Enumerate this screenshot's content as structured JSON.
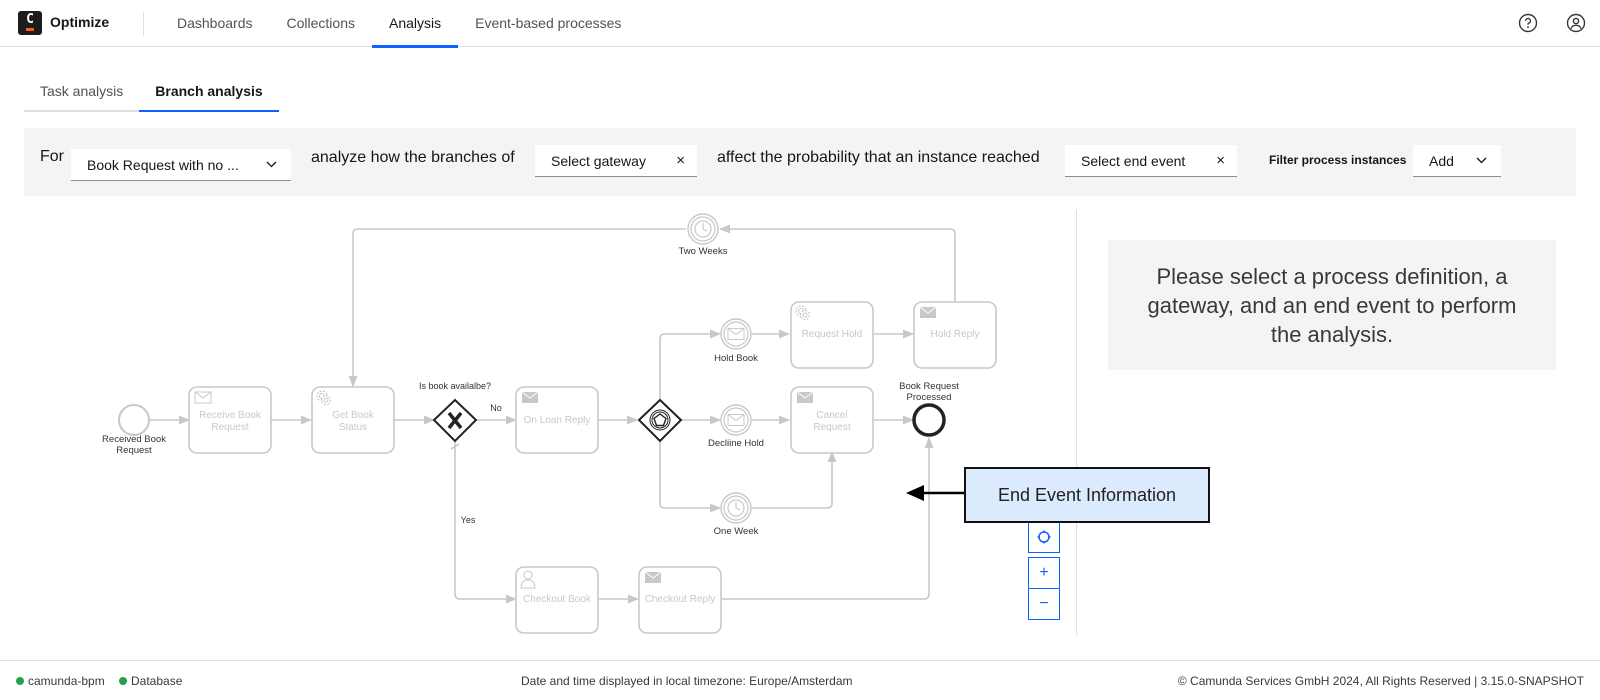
{
  "header": {
    "logo_letter": "C",
    "app_name": "Optimize",
    "nav": [
      {
        "label": "Dashboards",
        "active": false
      },
      {
        "label": "Collections",
        "active": false
      },
      {
        "label": "Analysis",
        "active": true
      },
      {
        "label": "Event-based processes",
        "active": false
      }
    ],
    "icons": [
      "help-icon",
      "user-icon"
    ]
  },
  "subtabs": [
    {
      "label": "Task analysis",
      "active": false
    },
    {
      "label": "Branch analysis",
      "active": true
    }
  ],
  "controls": {
    "for_label": "For",
    "process_value": "Book Request with no ...",
    "analyze_text": "analyze how the branches of",
    "gateway_value": "Select gateway",
    "affect_text": "affect the probability that an instance reached",
    "end_event_value": "Select end event",
    "filter_label": "Filter process instances",
    "filter_value": "Add",
    "clear_symbol": "×",
    "chevron_symbol": "⌄"
  },
  "diagram": {
    "nodes": {
      "start": "Received Book Request",
      "receive": "Receive Book Request",
      "get_status": "Get Book Status",
      "gateway_label": "Is book availalbe?",
      "on_loan": "On Loan Reply",
      "hold_book": "Hold Book",
      "decline_hold": "Decliine Hold",
      "one_week": "One Week",
      "two_weeks": "Two Weeks",
      "request_hold": "Request Hold",
      "hold_reply": "Hold Reply",
      "cancel_request": "Cancel Request",
      "end": "Book Request Processed",
      "checkout_book": "Checkout Book",
      "checkout_reply": "Checkout Reply"
    },
    "flow_labels": {
      "no": "No",
      "yes": "Yes"
    },
    "zoom_controls": {
      "reset": "⌖",
      "zoom_in": "+",
      "zoom_out": "−"
    }
  },
  "annotation": {
    "text": "End Event Information"
  },
  "message": {
    "text": "Please select a process definition, a gateway, and an end event to perform the analysis."
  },
  "footer": {
    "statuses": [
      {
        "label": "camunda-bpm",
        "color": "#24a148"
      },
      {
        "label": "Database",
        "color": "#24a148"
      }
    ],
    "timezone": "Date and time displayed in local timezone: Europe/Amsterdam",
    "copyright": "© Camunda Services GmbH 2024, All Rights Reserved | 3.15.0-SNAPSHOT"
  },
  "colors": {
    "accent": "#0f62fe",
    "status_ok": "#24a148",
    "annotation_bg": "#dbeafc",
    "logo_accent": "#fc5d0d"
  }
}
